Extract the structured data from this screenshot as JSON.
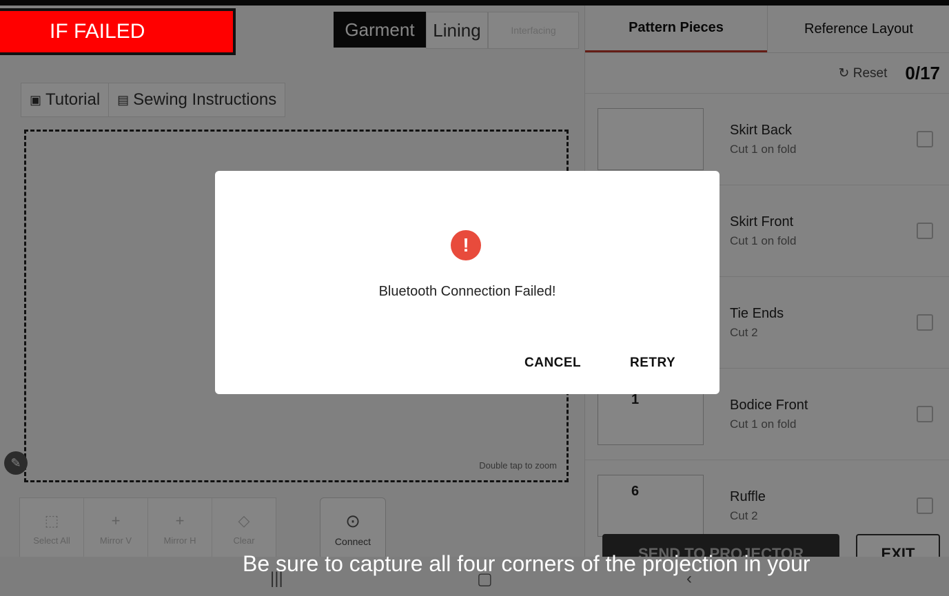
{
  "overlay_banner": "IF FAILED",
  "garment_tabs": [
    "Garment",
    "Lining",
    "Interfacing"
  ],
  "toolbar": {
    "tutorial": "Tutorial",
    "sewing_instructions": "Sewing Instructions"
  },
  "canvas": {
    "zoom_hint": "Double tap to zoom"
  },
  "tools": [
    "Select All",
    "Mirror V",
    "Mirror H",
    "Clear"
  ],
  "connect_label": "Connect",
  "right_tabs": [
    "Pattern Pieces",
    "Reference Layout"
  ],
  "reset_label": "Reset",
  "progress": "0/17",
  "pieces": [
    {
      "name": "Skirt Back",
      "cut": "Cut 1 on fold",
      "num": ""
    },
    {
      "name": "Skirt Front",
      "cut": "Cut 1 on fold",
      "num": ""
    },
    {
      "name": "Tie Ends",
      "cut": "Cut 2",
      "num": ""
    },
    {
      "name": "Bodice Front",
      "cut": "Cut 1 on fold",
      "num": "1"
    },
    {
      "name": "Ruffle",
      "cut": "Cut 2",
      "num": "6"
    }
  ],
  "send_button": "SEND TO PROJECTOR",
  "exit_button": "EXIT",
  "dialog": {
    "message": "Bluetooth Connection Failed!",
    "cancel": "CANCEL",
    "retry": "RETRY"
  },
  "caption": "Be sure to capture all four corners of the projection in your"
}
